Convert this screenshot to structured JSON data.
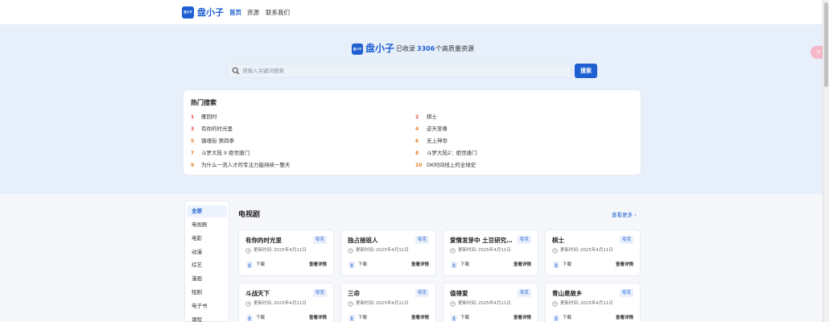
{
  "nav": {
    "logo_text": "盘小子",
    "brand": "盘小子",
    "links": [
      "首页",
      "资源",
      "联系我们"
    ]
  },
  "hero": {
    "logo_text": "盘小子",
    "brand": "盘小子",
    "prefix": "已收录",
    "count": "3306",
    "suffix": "个高质量资源"
  },
  "search": {
    "placeholder": "请输入关键词搜索",
    "value": "",
    "button": "搜索"
  },
  "hot": {
    "title": "热门搜索",
    "items": [
      {
        "num": "1",
        "text": "雁回时"
      },
      {
        "num": "2",
        "text": "棋士"
      },
      {
        "num": "3",
        "text": "有你的时光里"
      },
      {
        "num": "4",
        "text": "逆天至尊"
      },
      {
        "num": "5",
        "text": "镇魂街 第四季"
      },
      {
        "num": "6",
        "text": "无上神帝"
      },
      {
        "num": "7",
        "text": "斗罗大陆 II 绝世唐门"
      },
      {
        "num": "8",
        "text": "斗罗大陆2：绝世唐门"
      },
      {
        "num": "9",
        "text": "为什么一流人才的专注力能持续一整天"
      },
      {
        "num": "10",
        "text": "DK时间线上的全球史"
      }
    ]
  },
  "float_button": {
    "icon": "sparkle-icon",
    "glyph": "✧"
  },
  "sidebar": {
    "items": [
      "全部",
      "电视剧",
      "电影",
      "动漫",
      "综艺",
      "漫画",
      "短剧",
      "电子书",
      "课程"
    ],
    "active": 0
  },
  "section": {
    "title": "电视剧",
    "more": "查看更多",
    "cards": [
      {
        "title": "有你的时光里",
        "tag": "夸克",
        "time_label": "更新时间:",
        "time": "2025年4月11日",
        "download": "下载",
        "detail": "查看详情"
      },
      {
        "title": "独占接班人",
        "tag": "夸克",
        "time_label": "更新时间:",
        "time": "2025年4月11日",
        "download": "下载",
        "detail": "查看详情"
      },
      {
        "title": "爱情发芽中 土豆研究…",
        "tag": "夸克",
        "time_label": "更新时间:",
        "time": "2025年4月11日",
        "download": "下载",
        "detail": "查看详情"
      },
      {
        "title": "棋士",
        "tag": "夸克",
        "time_label": "更新时间:",
        "time": "2025年4月11日",
        "download": "下载",
        "detail": "查看详情"
      },
      {
        "title": "斗战天下",
        "tag": "夸克",
        "time_label": "更新时间:",
        "time": "2025年4月11日",
        "download": "下载",
        "detail": "查看详情"
      },
      {
        "title": "三命",
        "tag": "夸克",
        "time_label": "更新时间:",
        "time": "2025年4月11日",
        "download": "下载",
        "detail": "查看详情"
      },
      {
        "title": "值得爱",
        "tag": "夸克",
        "time_label": "更新时间:",
        "time": "2025年4月11日",
        "download": "下载",
        "detail": "查看详情"
      },
      {
        "title": "青山是故乡",
        "tag": "夸克",
        "time_label": "更新时间:",
        "time": "2025年4月11日",
        "download": "下载",
        "detail": "查看详情"
      }
    ]
  },
  "colors": {
    "accent": "#1e5fd1",
    "hero_bg": "#e6effa",
    "page_bg": "#f5f7fb",
    "hot_top": "#e74c3c",
    "hot_other": "#e67e22"
  }
}
